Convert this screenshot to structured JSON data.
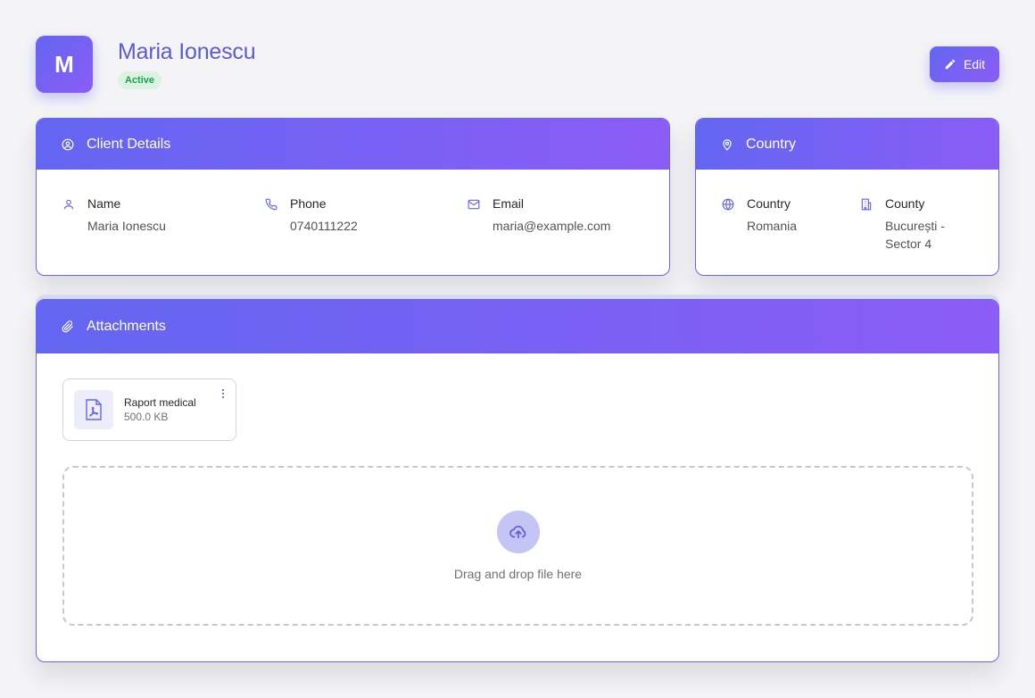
{
  "header": {
    "avatar_initial": "M",
    "client_name": "Maria Ionescu",
    "status": "Active",
    "edit_label": "Edit"
  },
  "client_details": {
    "title": "Client Details",
    "fields": [
      {
        "label": "Name",
        "value": "Maria Ionescu",
        "icon": "user-icon"
      },
      {
        "label": "Phone",
        "value": "0740111222",
        "icon": "phone-icon"
      },
      {
        "label": "Email",
        "value": "maria@example.com",
        "icon": "mail-icon"
      }
    ]
  },
  "country_card": {
    "title": "Country",
    "fields": [
      {
        "label": "Country",
        "value": "Romania",
        "icon": "globe-icon"
      },
      {
        "label": "County",
        "value": "București - Sector 4",
        "icon": "building-icon"
      }
    ]
  },
  "attachments": {
    "title": "Attachments",
    "files": [
      {
        "name": "Raport medical",
        "size": "500.0 KB",
        "icon": "pdf-file-icon"
      }
    ],
    "dropzone_text": "Drag and drop file here"
  },
  "colors": {
    "accent": "#6366f1",
    "accent_end": "#8b5cf6",
    "status_bg": "#dcf3e3",
    "status_text": "#16a34a"
  }
}
